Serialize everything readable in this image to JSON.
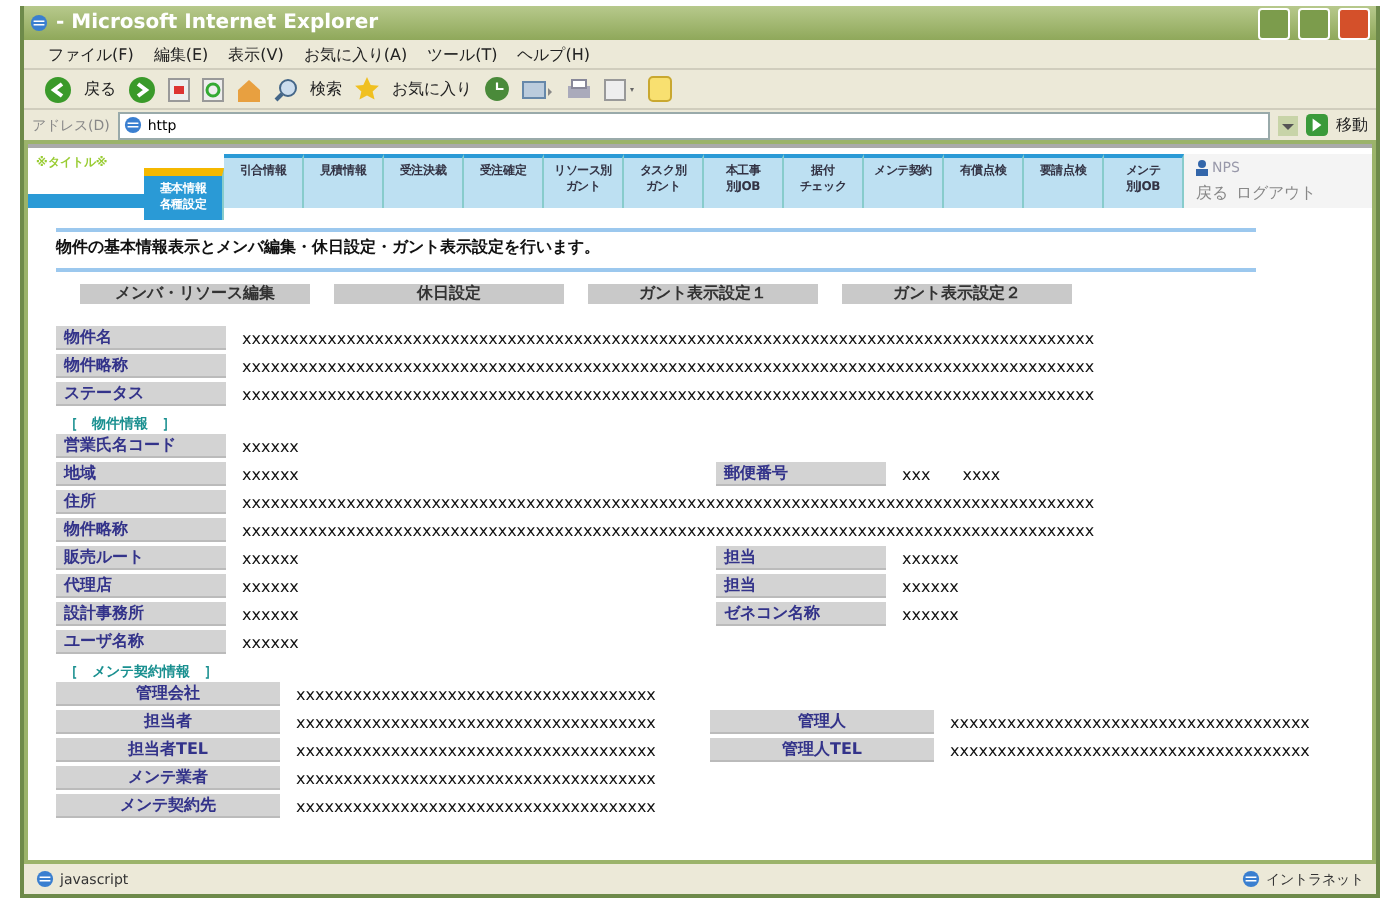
{
  "window": {
    "title": "- Microsoft Internet Explorer"
  },
  "menu": [
    "ファイル(F)",
    "編集(E)",
    "表示(V)",
    "お気に入り(A)",
    "ツール(T)",
    "ヘルプ(H)"
  ],
  "toolbar": {
    "back": "戻る",
    "search": "検索",
    "favorites": "お気に入り"
  },
  "address": {
    "label": "アドレス(D)",
    "value": "http",
    "go": "移動"
  },
  "nav": {
    "logo": "※タイトル※",
    "user": "NPS",
    "back": "戻る",
    "logout": "ログアウト",
    "tabs": [
      {
        "lines": [
          "基本情報",
          "各種設定"
        ],
        "selected": true
      },
      {
        "lines": [
          "引合情報"
        ],
        "selected": false
      },
      {
        "lines": [
          "見積情報"
        ],
        "selected": false
      },
      {
        "lines": [
          "受注決裁"
        ],
        "selected": false
      },
      {
        "lines": [
          "受注確定"
        ],
        "selected": false
      },
      {
        "lines": [
          "リソース別",
          "ガント"
        ],
        "selected": false
      },
      {
        "lines": [
          "タスク別",
          "ガント"
        ],
        "selected": false
      },
      {
        "lines": [
          "本工事",
          "別JOB"
        ],
        "selected": false
      },
      {
        "lines": [
          "据付",
          "チェック"
        ],
        "selected": false
      },
      {
        "lines": [
          "メンテ契約"
        ],
        "selected": false
      },
      {
        "lines": [
          "有償点検"
        ],
        "selected": false
      },
      {
        "lines": [
          "要請点検"
        ],
        "selected": false
      },
      {
        "lines": [
          "メンテ",
          "別JOB"
        ],
        "selected": false
      }
    ]
  },
  "intro": "物件の基本情報表示とメンバ編集・休日設定・ガント表示設定を行います。",
  "actions": [
    "メンバ・リソース編集",
    "休日設定",
    "ガント表示設定１",
    "ガント表示設定２"
  ],
  "basic": [
    {
      "label": "物件名",
      "value": "xxxxxxxxxxxxxxxxxxxxxxxxxxxxxxxxxxxxxxxxxxxxxxxxxxxxxxxxxxxxxxxxxxxxxxxxxxxxxxxxxxxxxxxxxx"
    },
    {
      "label": "物件略称",
      "value": "xxxxxxxxxxxxxxxxxxxxxxxxxxxxxxxxxxxxxxxxxxxxxxxxxxxxxxxxxxxxxxxxxxxxxxxxxxxxxxxxxxxxxxxxxx"
    },
    {
      "label": "ステータス",
      "value": "xxxxxxxxxxxxxxxxxxxxxxxxxxxxxxxxxxxxxxxxxxxxxxxxxxxxxxxxxxxxxxxxxxxxxxxxxxxxxxxxxxxxxxxxxx"
    }
  ],
  "property": {
    "heading": "［　物件情報　］",
    "rows": [
      [
        {
          "label": "営業氏名コード",
          "value": "xxxxxx"
        }
      ],
      [
        {
          "label": "地域",
          "value": "xxxxxx"
        },
        {
          "label": "郵便番号",
          "value": "xxx　　xxxx"
        }
      ],
      [
        {
          "label": "住所",
          "value": "xxxxxxxxxxxxxxxxxxxxxxxxxxxxxxxxxxxxxxxxxxxxxxxxxxxxxxxxxxxxxxxxxxxxxxxxxxxxxxxxxxxxxxxxxx"
        }
      ],
      [
        {
          "label": "物件略称",
          "value": "xxxxxxxxxxxxxxxxxxxxxxxxxxxxxxxxxxxxxxxxxxxxxxxxxxxxxxxxxxxxxxxxxxxxxxxxxxxxxxxxxxxxxxxxxx"
        }
      ],
      [
        {
          "label": "販売ルート",
          "value": "xxxxxx"
        },
        {
          "label": "担当",
          "value": "xxxxxx"
        }
      ],
      [
        {
          "label": "代理店",
          "value": "xxxxxx"
        },
        {
          "label": "担当",
          "value": "xxxxxx"
        }
      ],
      [
        {
          "label": "設計事務所",
          "value": "xxxxxx"
        },
        {
          "label": "ゼネコン名称",
          "value": "xxxxxx"
        }
      ],
      [
        {
          "label": "ユーザ名称",
          "value": "xxxxxx"
        }
      ]
    ]
  },
  "maintenance": {
    "heading": "［　メンテ契約情報　］",
    "rows": [
      [
        {
          "label": "管理会社",
          "value": "xxxxxxxxxxxxxxxxxxxxxxxxxxxxxxxxxxxxxx"
        }
      ],
      [
        {
          "label": "担当者",
          "value": "xxxxxxxxxxxxxxxxxxxxxxxxxxxxxxxxxxxxxx"
        },
        {
          "label": "管理人",
          "value": "xxxxxxxxxxxxxxxxxxxxxxxxxxxxxxxxxxxxxx"
        }
      ],
      [
        {
          "label": "担当者TEL",
          "value": "xxxxxxxxxxxxxxxxxxxxxxxxxxxxxxxxxxxxxx"
        },
        {
          "label": "管理人TEL",
          "value": "xxxxxxxxxxxxxxxxxxxxxxxxxxxxxxxxxxxxxx"
        }
      ],
      [
        {
          "label": "メンテ業者",
          "value": "xxxxxxxxxxxxxxxxxxxxxxxxxxxxxxxxxxxxxx"
        }
      ],
      [
        {
          "label": "メンテ契約先",
          "value": "xxxxxxxxxxxxxxxxxxxxxxxxxxxxxxxxxxxxxx"
        }
      ]
    ]
  },
  "status": {
    "left": "javascript",
    "right": "イントラネット"
  }
}
